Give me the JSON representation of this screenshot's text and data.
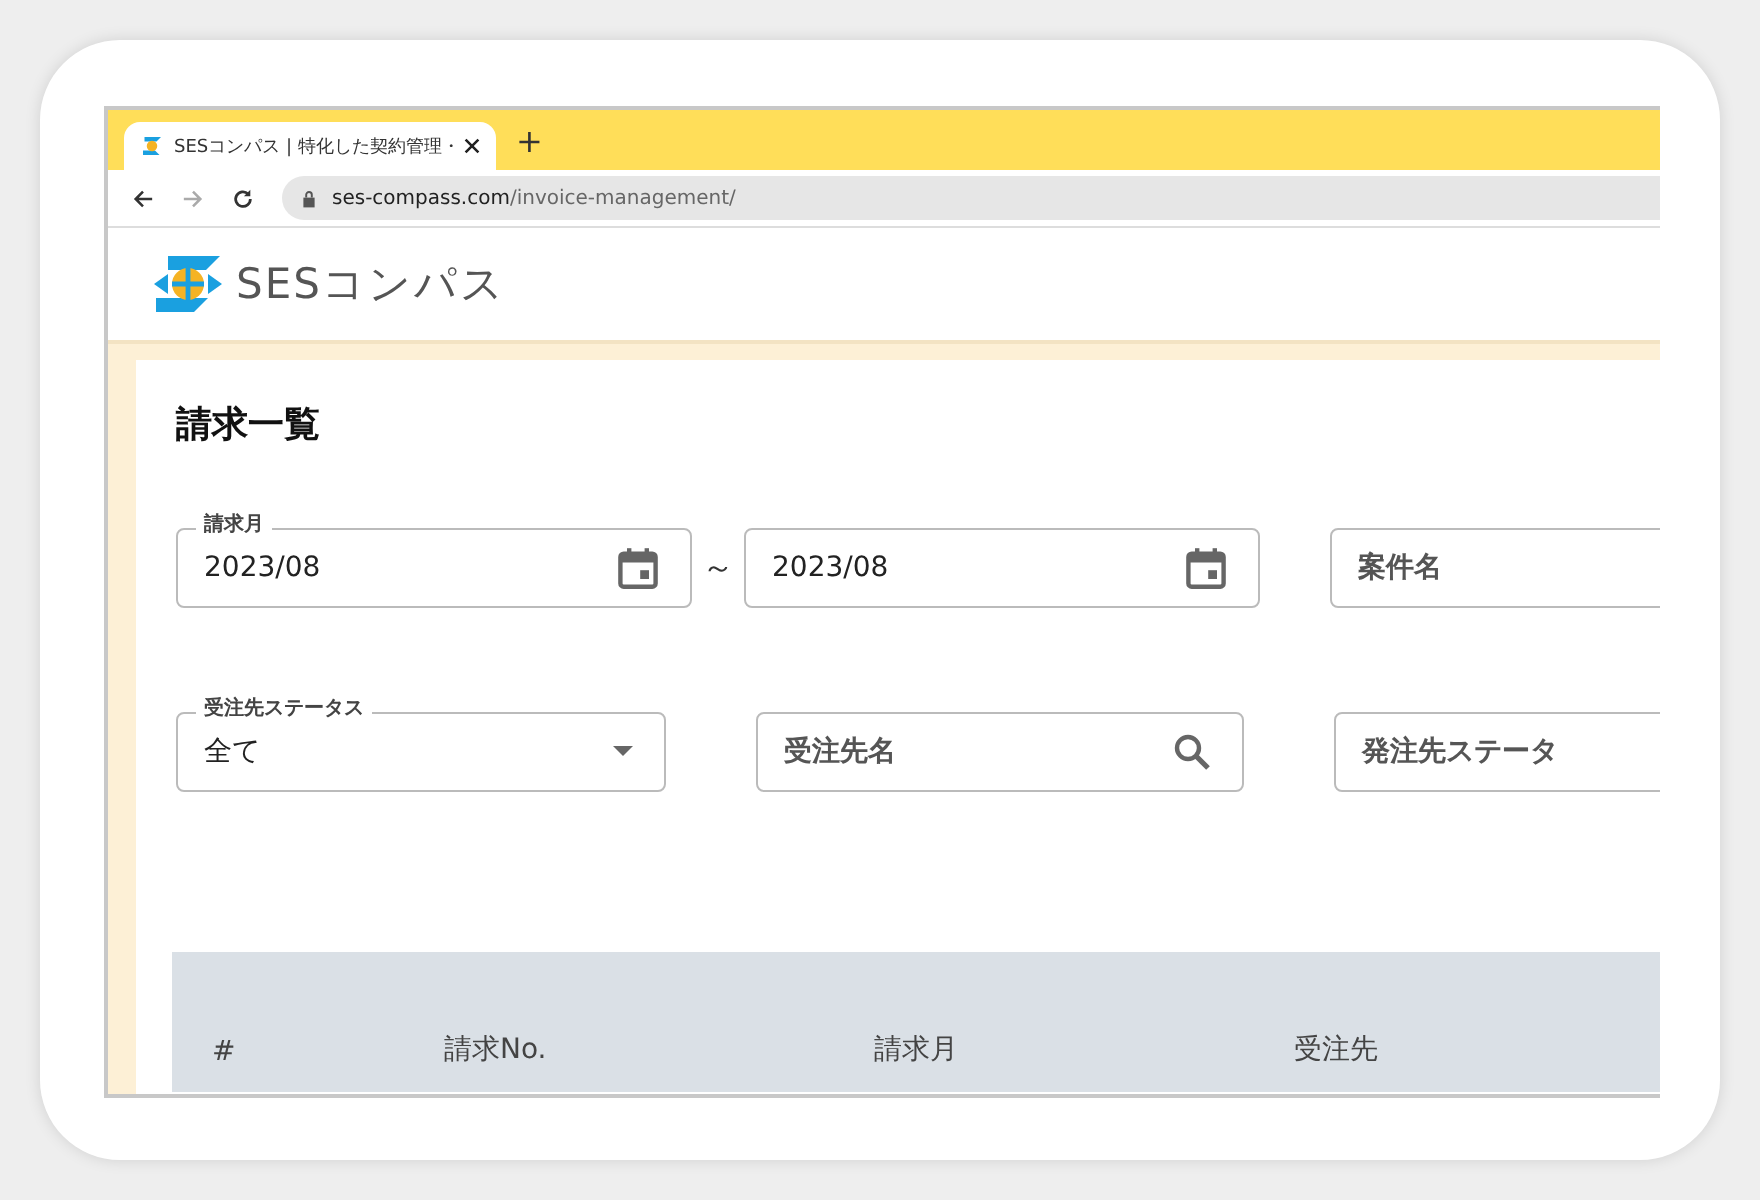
{
  "browser": {
    "tab_title": "SESコンパス | 特化した契約管理・",
    "new_tab": "+",
    "url_host": "ses-compass.com",
    "url_path": "/invoice-management/"
  },
  "app": {
    "logo_text": "SESコンパス"
  },
  "page": {
    "title": "請求一覧"
  },
  "filters": [
    {
      "kind": "date",
      "label": "請求月",
      "value": "2023/08"
    },
    {
      "kind": "separator",
      "text": "～"
    },
    {
      "kind": "date",
      "value": "2023/08"
    },
    {
      "kind": "text",
      "placeholder": "案件名"
    }
  ],
  "filters_row2": [
    {
      "kind": "select",
      "label": "受注先ステータス",
      "value": "全て"
    },
    {
      "kind": "search",
      "placeholder": "受注先名"
    },
    {
      "kind": "text",
      "placeholder": "発注先ステータ"
    }
  ],
  "table": {
    "columns": [
      "#",
      "請求No.",
      "請求月",
      "受注先"
    ]
  }
}
